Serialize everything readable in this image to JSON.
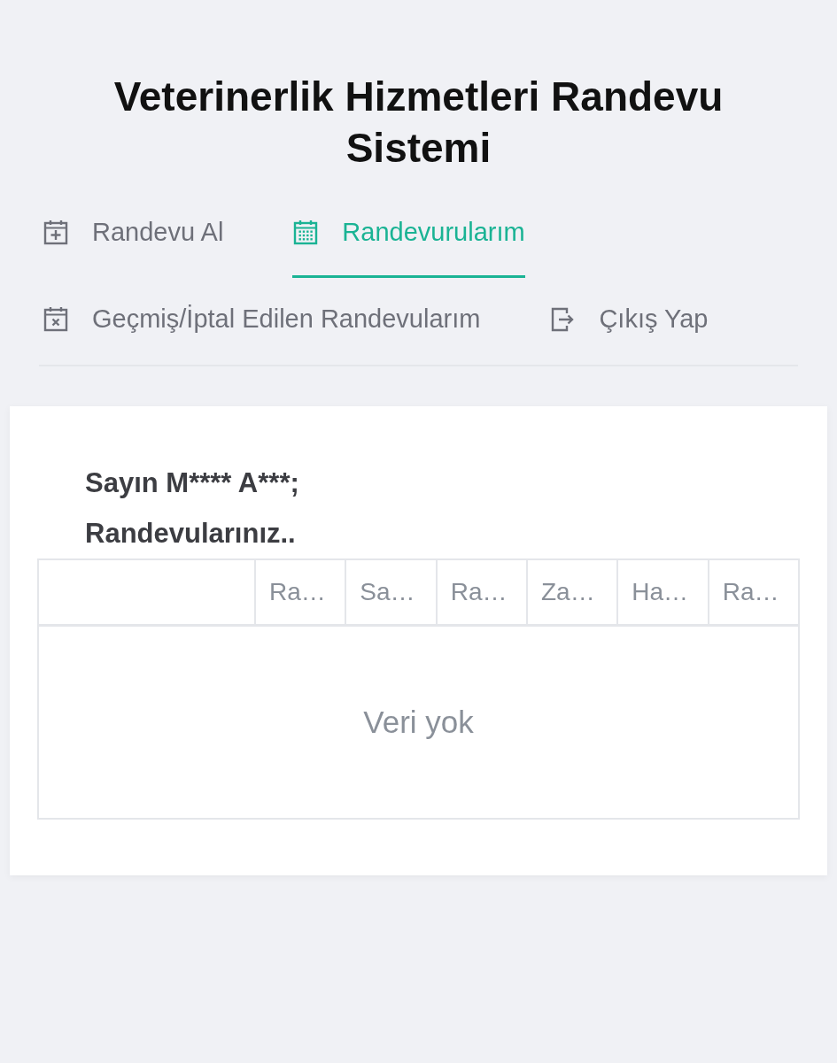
{
  "title": "Veterinerlik Hizmetleri Randevu Sistemi",
  "tabs": [
    {
      "label": "Randevu Al",
      "selected": false
    },
    {
      "label": "Randevurularım",
      "selected": true
    },
    {
      "label": "Geçmiş/İptal Edilen Randevularım",
      "selected": false
    },
    {
      "label": "Çıkış Yap",
      "selected": false
    }
  ],
  "greeting": "Sayın M**** A***;",
  "subtitle": "Randevularınız..",
  "table": {
    "columns": [
      "Ra…",
      "Sa…",
      "Ra…",
      "Za…",
      "Ha…",
      "Ra…"
    ],
    "empty_text": "Veri yok"
  }
}
